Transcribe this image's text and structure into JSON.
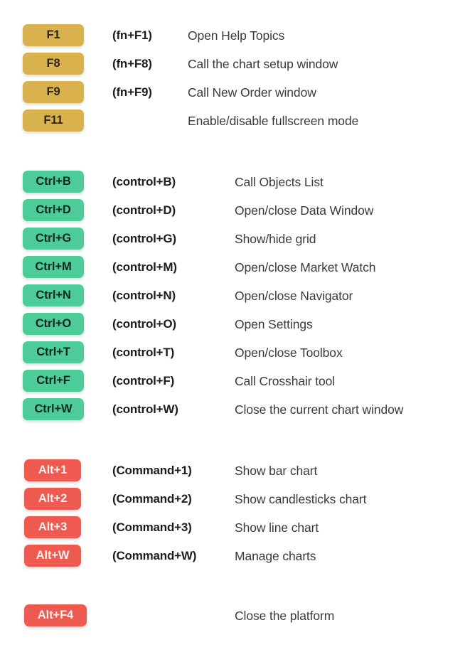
{
  "theme": {
    "background": "#ffffff",
    "key_gold_bg": "#d9b24e",
    "key_gold_text": "#2f2611",
    "key_green_bg": "#4ecb9a",
    "key_green_text": "#0d2620",
    "key_red_bg": "#ef5a50",
    "key_red_text": "#fdf0ef",
    "alt_text": "#1c1c1c",
    "desc_text": "#3a3a3a"
  },
  "sections": [
    {
      "id": "function-keys",
      "color": "gold",
      "desc_column": "near",
      "rows": [
        {
          "key": "F1",
          "alt": "(fn+F1)",
          "desc": "Open Help Topics"
        },
        {
          "key": "F8",
          "alt": "(fn+F8)",
          "desc": "Call the chart setup window"
        },
        {
          "key": "F9",
          "alt": "(fn+F9)",
          "desc": "Call New Order window"
        },
        {
          "key": "F11",
          "alt": "",
          "desc": "Enable/disable fullscreen mode"
        }
      ]
    },
    {
      "id": "control-keys",
      "color": "green",
      "desc_column": "far",
      "rows": [
        {
          "key": "Ctrl+B",
          "alt": "(control+B)",
          "desc": "Call Objects List"
        },
        {
          "key": "Ctrl+D",
          "alt": "(control+D)",
          "desc": "Open/close Data Window"
        },
        {
          "key": "Ctrl+G",
          "alt": "(control+G)",
          "desc": "Show/hide grid"
        },
        {
          "key": "Ctrl+M",
          "alt": "(control+M)",
          "desc": "Open/close Market Watch"
        },
        {
          "key": "Ctrl+N",
          "alt": "(control+N)",
          "desc": "Open/close Navigator"
        },
        {
          "key": "Ctrl+O",
          "alt": "(control+O)",
          "desc": "Open Settings"
        },
        {
          "key": "Ctrl+T",
          "alt": "(control+T)",
          "desc": "Open/close Toolbox"
        },
        {
          "key": "Ctrl+F",
          "alt": "(control+F)",
          "desc": "Call Crosshair tool"
        },
        {
          "key": "Ctrl+W",
          "alt": "(control+W)",
          "desc": "Close the current chart window"
        }
      ]
    },
    {
      "id": "alt-keys",
      "color": "red",
      "desc_column": "far",
      "rows": [
        {
          "key": "Alt+1",
          "alt": "(Command+1)",
          "desc": "Show bar chart"
        },
        {
          "key": "Alt+2",
          "alt": "(Command+2)",
          "desc": "Show candlesticks chart"
        },
        {
          "key": "Alt+3",
          "alt": "(Command+3)",
          "desc": "Show line chart"
        },
        {
          "key": "Alt+W",
          "alt": "(Command+W)",
          "desc": "Manage charts"
        }
      ]
    },
    {
      "id": "close-platform",
      "color": "red",
      "desc_column": "far",
      "rows": [
        {
          "key": "Alt+F4",
          "alt": "",
          "desc": "Close the platform",
          "wide": true
        }
      ]
    }
  ]
}
